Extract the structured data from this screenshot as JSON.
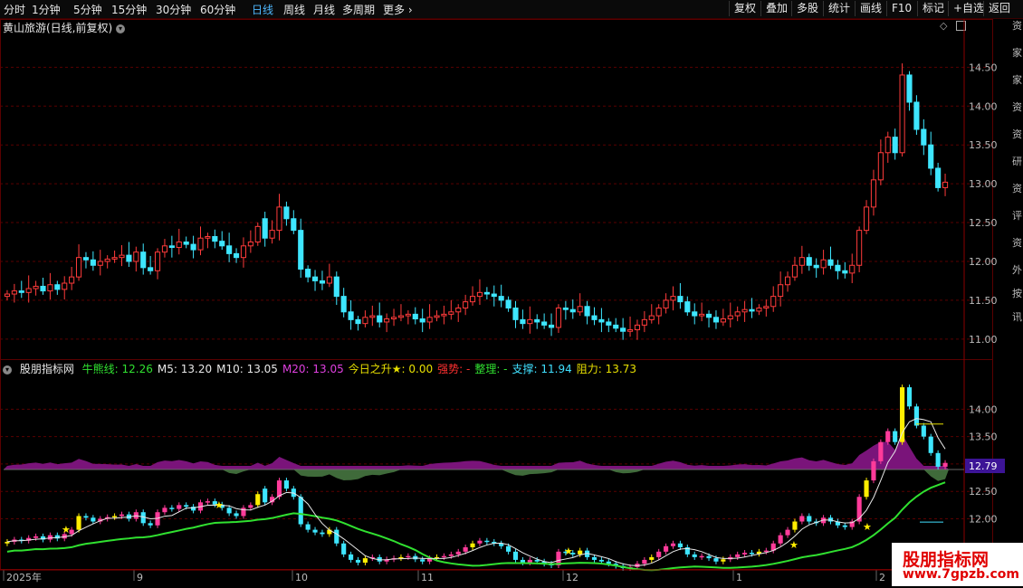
{
  "toolbar": {
    "periods": [
      "分时",
      "1分钟",
      "5分钟",
      "15分钟",
      "30分钟",
      "60分钟",
      "日线",
      "周线",
      "月线",
      "多周期",
      "更多"
    ],
    "active_period": "日线",
    "right_buttons": [
      "复权",
      "叠加",
      "多股",
      "统计",
      "画线",
      "F10",
      "标记",
      "+自选",
      "返回"
    ]
  },
  "main_title": "黄山旅游(日线,前复权)",
  "indicator": {
    "name": "股朋指标网",
    "items": [
      {
        "label": "牛熊线: ",
        "value": "12.26",
        "color": "#30e030"
      },
      {
        "label": "M5: ",
        "value": "13.20",
        "color": "#e8e8e8"
      },
      {
        "label": "M10: ",
        "value": "13.05",
        "color": "#e8e8e8"
      },
      {
        "label": "M20: ",
        "value": "13.05",
        "color": "#e040e0"
      },
      {
        "label": "今日之升★: ",
        "value": "0.00",
        "color": "#e8e000"
      },
      {
        "label": "强势: ",
        "value": "-",
        "color": "#ff3030"
      },
      {
        "label": "整理: ",
        "value": "-",
        "color": "#30e030"
      },
      {
        "label": "支撑: ",
        "value": "11.94",
        "color": "#40e0ff"
      },
      {
        "label": "阻力: ",
        "value": "13.73",
        "color": "#e8e000"
      }
    ],
    "current_value_tag": "12.79"
  },
  "right_sidebar_glyphs": [
    "资",
    "家",
    "家",
    "资",
    "资",
    "研",
    "资",
    "评",
    "资",
    "外",
    "按",
    "讯"
  ],
  "watermark": {
    "line1": "股朋指标网",
    "line2": "www.7gpzb.com"
  },
  "chart_data": [
    {
      "type": "candlestick",
      "title": "黄山旅游(日线,前复权)",
      "y_ticks": [
        11.0,
        11.5,
        12.0,
        12.5,
        13.0,
        13.5,
        14.0,
        14.5
      ],
      "ylim": [
        10.8,
        14.9
      ],
      "x_ticks": [
        "2025年",
        "9",
        "10",
        "11",
        "12",
        "1",
        "2"
      ],
      "series_close": [
        11.58,
        11.62,
        11.6,
        11.65,
        11.68,
        11.62,
        11.7,
        11.64,
        11.72,
        11.8,
        12.05,
        12.02,
        11.95,
        12.0,
        12.03,
        12.05,
        12.08,
        12.0,
        12.12,
        11.92,
        11.88,
        12.12,
        12.2,
        12.18,
        12.25,
        12.22,
        12.15,
        12.3,
        12.32,
        12.26,
        12.2,
        12.1,
        12.05,
        12.2,
        12.25,
        12.45,
        12.3,
        12.4,
        12.7,
        12.55,
        12.4,
        11.9,
        11.8,
        11.75,
        11.72,
        11.8,
        11.55,
        11.35,
        11.25,
        11.2,
        11.28,
        11.3,
        11.22,
        11.26,
        11.28,
        11.3,
        11.32,
        11.26,
        11.22,
        11.28,
        11.3,
        11.32,
        11.35,
        11.4,
        11.48,
        11.55,
        11.6,
        11.58,
        11.55,
        11.5,
        11.4,
        11.25,
        11.2,
        11.25,
        11.22,
        11.18,
        11.15,
        11.4,
        11.38,
        11.35,
        11.42,
        11.3,
        11.25,
        11.22,
        11.18,
        11.14,
        11.1,
        11.12,
        11.18,
        11.25,
        11.3,
        11.4,
        11.5,
        11.55,
        11.48,
        11.35,
        11.3,
        11.32,
        11.28,
        11.22,
        11.26,
        11.3,
        11.35,
        11.38,
        11.36,
        11.4,
        11.42,
        11.55,
        11.7,
        11.8,
        11.95,
        12.05,
        11.95,
        11.92,
        12.02,
        11.95,
        11.88,
        11.85,
        11.95,
        12.4,
        12.7,
        13.05,
        13.4,
        13.6,
        13.4,
        14.4,
        14.05,
        13.7,
        13.5,
        13.2,
        12.95,
        13.02
      ],
      "series_open": [
        11.55,
        11.58,
        11.62,
        11.6,
        11.65,
        11.68,
        11.62,
        11.7,
        11.64,
        11.72,
        11.8,
        12.05,
        12.02,
        11.95,
        12.0,
        12.03,
        12.05,
        12.08,
        12.0,
        12.12,
        11.92,
        11.88,
        12.12,
        12.2,
        12.18,
        12.25,
        12.22,
        12.15,
        12.3,
        12.32,
        12.26,
        12.2,
        12.1,
        12.05,
        12.2,
        12.25,
        12.55,
        12.3,
        12.4,
        12.7,
        12.55,
        12.4,
        11.9,
        11.8,
        11.75,
        11.72,
        11.8,
        11.55,
        11.35,
        11.25,
        11.2,
        11.28,
        11.3,
        11.22,
        11.26,
        11.28,
        11.3,
        11.32,
        11.26,
        11.22,
        11.28,
        11.3,
        11.32,
        11.35,
        11.4,
        11.48,
        11.55,
        11.6,
        11.58,
        11.55,
        11.5,
        11.4,
        11.25,
        11.2,
        11.25,
        11.22,
        11.18,
        11.15,
        11.4,
        11.38,
        11.35,
        11.42,
        11.3,
        11.25,
        11.22,
        11.18,
        11.14,
        11.1,
        11.12,
        11.18,
        11.25,
        11.3,
        11.4,
        11.5,
        11.55,
        11.48,
        11.35,
        11.3,
        11.32,
        11.28,
        11.22,
        11.26,
        11.3,
        11.35,
        11.38,
        11.36,
        11.4,
        11.42,
        11.55,
        11.7,
        11.8,
        11.95,
        12.05,
        11.95,
        11.92,
        12.02,
        11.95,
        11.88,
        11.85,
        11.95,
        12.4,
        12.7,
        13.05,
        13.4,
        13.6,
        13.4,
        14.4,
        14.05,
        13.7,
        13.5,
        13.2,
        12.95
      ]
    },
    {
      "type": "area",
      "title": "股朋指标网",
      "y_ticks": [
        12.0,
        12.5,
        13.0,
        13.5,
        14.0
      ],
      "series": [
        {
          "name": "牛熊线",
          "last": 12.26,
          "color": "#30e030"
        },
        {
          "name": "M5",
          "last": 13.2,
          "color": "#e8e8e8"
        },
        {
          "name": "M10",
          "last": 13.05,
          "color": "#e8e8e8"
        },
        {
          "name": "M20",
          "last": 13.05,
          "color": "#e040e0"
        }
      ],
      "supports": {
        "支撑": 11.94,
        "阻力": 13.73
      }
    }
  ],
  "colors": {
    "up": "#ff3b3b",
    "down": "#3ee6ff",
    "grid": "#5a0000",
    "frame": "#8a0000"
  }
}
